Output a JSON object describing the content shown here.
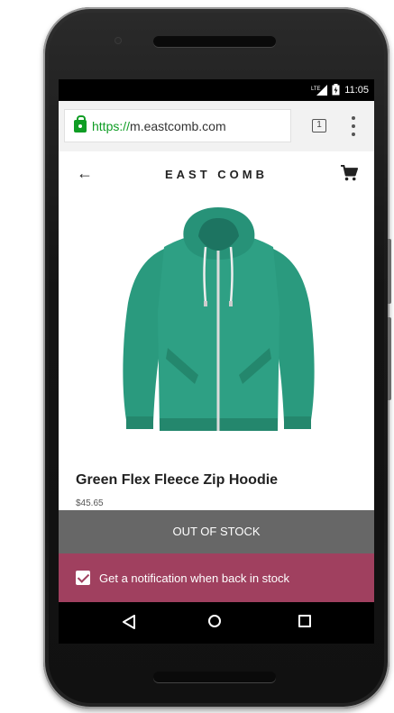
{
  "status_bar": {
    "network": "LTE",
    "time": "11:05"
  },
  "browser": {
    "url_scheme": "https://",
    "url_host": "m.eastcomb.com",
    "tab_count": "1"
  },
  "app_header": {
    "brand": "EAST COMB",
    "back_icon": "arrow-back-icon",
    "cart_icon": "shopping-cart-icon"
  },
  "product": {
    "image": "green-zip-hoodie",
    "title": "Green Flex Fleece Zip Hoodie",
    "price": "$45.65"
  },
  "stock_status": {
    "label": "OUT OF STOCK"
  },
  "notification": {
    "checked": true,
    "label": "Get a notification when back in stock"
  },
  "nav_bar": {
    "back": "nav-back-icon",
    "home": "nav-home-icon",
    "recents": "nav-recents-icon"
  },
  "colors": {
    "accent_green": "#0f9d24",
    "out_of_stock_bg": "#676767",
    "notify_bg": "#a0405f",
    "hoodie": "#2a9a7e"
  }
}
